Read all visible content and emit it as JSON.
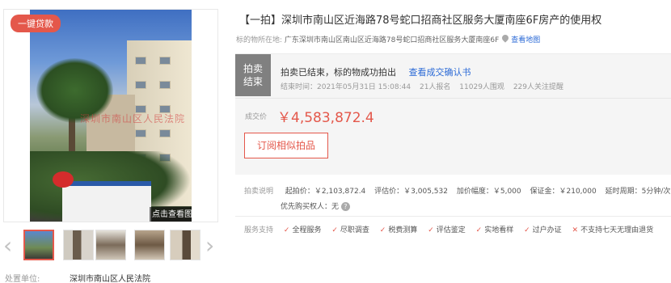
{
  "gallery": {
    "loan_tag": "一键贷款",
    "stamp_text": "深圳市南山区人民法院",
    "detail_overlay": "点击查看图片详情"
  },
  "court": {
    "label": "处置单位:",
    "value": "深圳市南山区人民法院"
  },
  "title": "【一拍】深圳市南山区近海路78号蛇口招商社区服务大厦南座6F房产的使用权",
  "location": {
    "label": "标的物所在地:",
    "address": "广东深圳市南山区南山区近海路78号蛇口招商社区服务大厦南座6F",
    "map_link": "查看地图"
  },
  "status": {
    "box_line1": "拍卖",
    "box_line2": "结束",
    "message": "拍卖已结束，标的物成功拍出",
    "cert_link": "查看成交确认书",
    "end_time": "结束时间：2021年05月31日 15:08:44",
    "signups": "21人报名",
    "views": "11029人围观",
    "followers": "229人关注提醒"
  },
  "price": {
    "label": "成交价",
    "value": "￥4,583,872.4"
  },
  "subscribe_button": "订阅相似拍品",
  "rules": {
    "label": "拍卖说明",
    "start_price": "起拍价：￥2,103,872.4",
    "assessed": "评估价：￥3,005,532",
    "increment": "加价幅度：￥5,000",
    "deposit": "保证金：￥210,000",
    "extension": "延时周期：5分钟/次",
    "priority": "优先购买权人：无"
  },
  "services": {
    "label": "服务支持",
    "items": [
      "全程服务",
      "尽职调查",
      "税费测算",
      "评估鉴定",
      "实地看样",
      "过户办证"
    ],
    "excluded": "不支持七天无理由退货"
  },
  "colors": {
    "accent": "#e4584b",
    "link": "#2b6ad6"
  },
  "icons": [
    "chevron-left-icon",
    "chevron-right-icon",
    "map-pin-icon",
    "help-icon",
    "check-icon",
    "cross-icon"
  ]
}
